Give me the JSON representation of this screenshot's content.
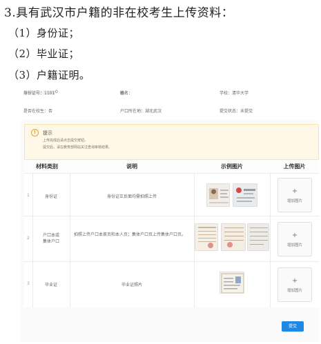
{
  "heading": "3.具有武汉市户籍的非在校考生上传资料：",
  "requirements": [
    "（1）身份证；",
    "（2）毕业证；",
    "（3）户籍证明。"
  ],
  "info": {
    "id_label": "身份证号：1101",
    "id_tail": "0",
    "name_label": "姓名：",
    "name_value": "徐",
    "school_label": "学校：清华大学",
    "in_school": "是否在校生：否",
    "hukou_location": "户口所在地：湖北武汉",
    "submit_status": "提交状态：未提交"
  },
  "notice": {
    "icon": "info-circle-icon",
    "title": "提示",
    "lines": [
      "上传完成后请点击提交按钮。",
      "提交后，请在教育部网站关注查询审核结果。"
    ]
  },
  "table": {
    "headers": [
      "材料类别",
      "说明",
      "示例图片",
      "上传图片"
    ],
    "rows": [
      {
        "index": "1",
        "category": "身份证",
        "description": "身份证正反面均需拍照上传",
        "upload_plus": "+",
        "upload_label": "增加图片"
      },
      {
        "index": "2",
        "category": "户口本或\n集体户口",
        "description": "拍照上传户口本首页和本人页；集体户口页上传集体户口页。",
        "upload_plus": "+",
        "upload_label": "增加图片"
      },
      {
        "index": "3",
        "category": "毕业证",
        "description": "毕业证照片",
        "upload_plus": "+",
        "upload_label": "增加图片"
      }
    ]
  },
  "submit_label": "提交",
  "colors": {
    "accent": "#1e88e5",
    "notice_bg": "#fff8e6",
    "notice_icon": "#f0a020"
  }
}
